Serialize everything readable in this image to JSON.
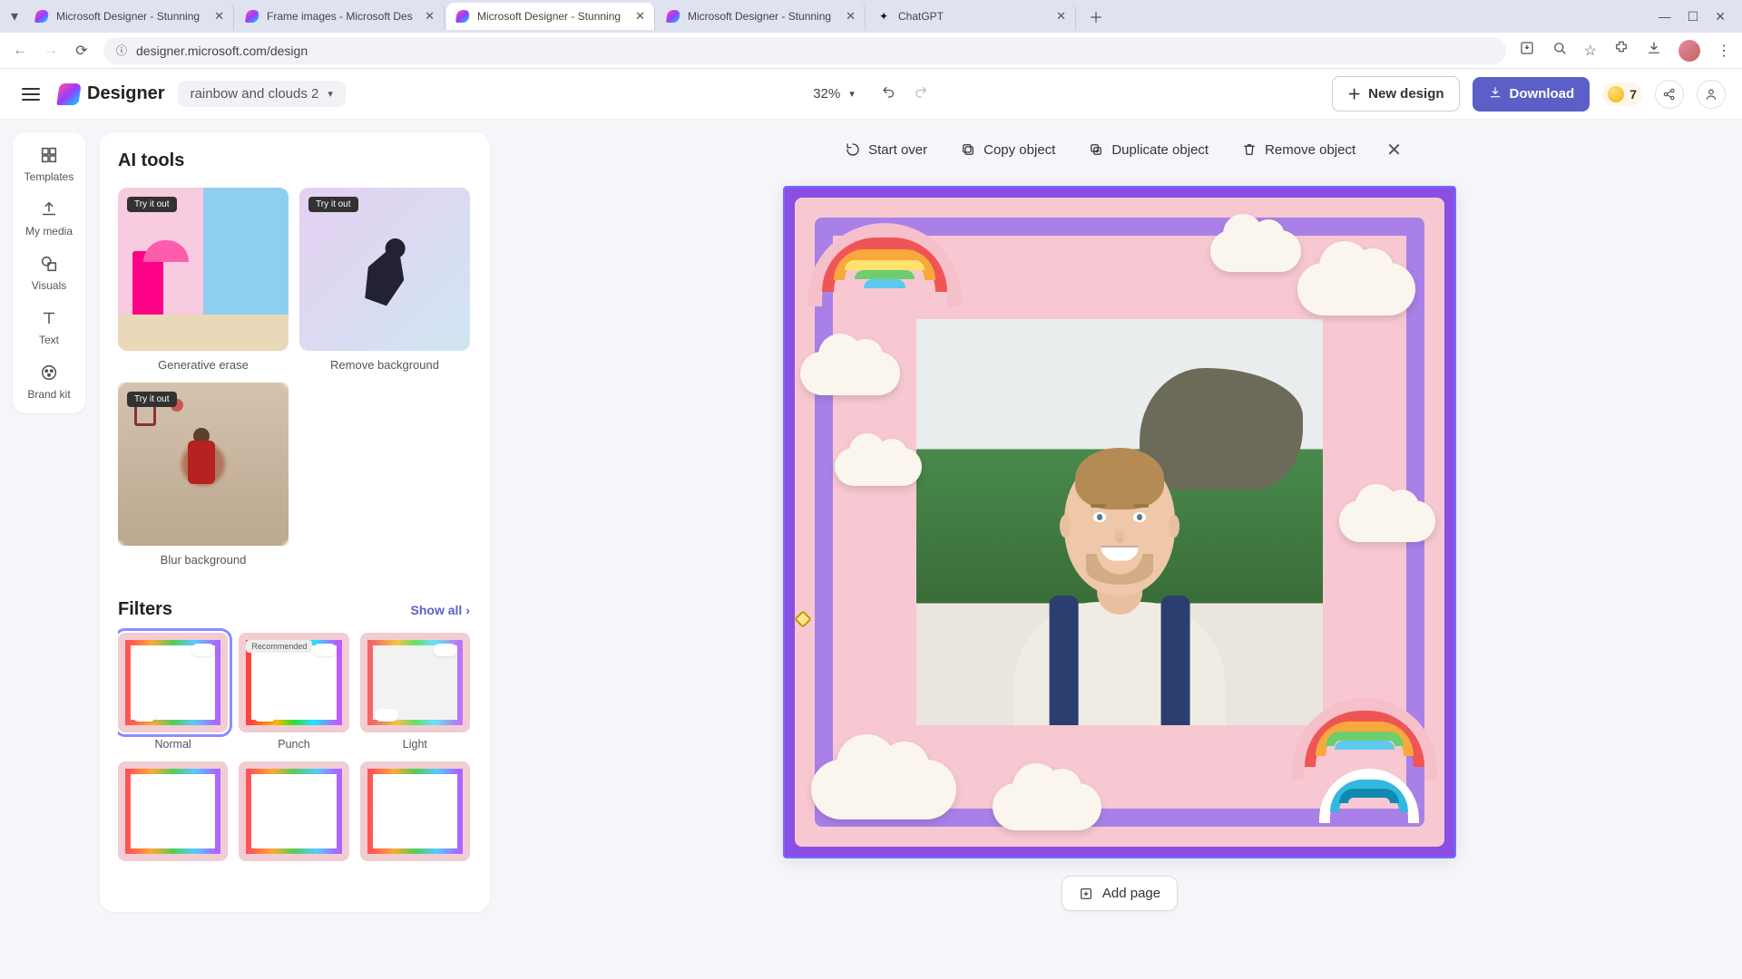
{
  "browser": {
    "tabs": [
      {
        "title": "Microsoft Designer - Stunning",
        "active": false
      },
      {
        "title": "Frame images - Microsoft Des",
        "active": false
      },
      {
        "title": "Microsoft Designer - Stunning",
        "active": true
      },
      {
        "title": "Microsoft Designer - Stunning",
        "active": false
      },
      {
        "title": "ChatGPT",
        "active": false
      }
    ],
    "url": "designer.microsoft.com/design"
  },
  "header": {
    "logo_text": "Designer",
    "file_name": "rainbow and clouds 2",
    "zoom": "32%",
    "new_design": "New design",
    "download": "Download",
    "credits": "7"
  },
  "rail": {
    "items": [
      "Templates",
      "My media",
      "Visuals",
      "Text",
      "Brand kit"
    ]
  },
  "panel": {
    "ai_title": "AI tools",
    "try_badge": "Try it out",
    "ai_tools": [
      {
        "label": "Generative erase"
      },
      {
        "label": "Remove background"
      },
      {
        "label": "Blur background"
      }
    ],
    "filters_title": "Filters",
    "show_all": "Show all",
    "recommended": "Recommended",
    "filters": [
      {
        "label": "Normal",
        "selected": true
      },
      {
        "label": "Punch",
        "recommended": true
      },
      {
        "label": "Light"
      }
    ]
  },
  "toolbar": {
    "start_over": "Start over",
    "copy": "Copy object",
    "duplicate": "Duplicate object",
    "remove": "Remove object"
  },
  "footer": {
    "add_page": "Add page"
  }
}
